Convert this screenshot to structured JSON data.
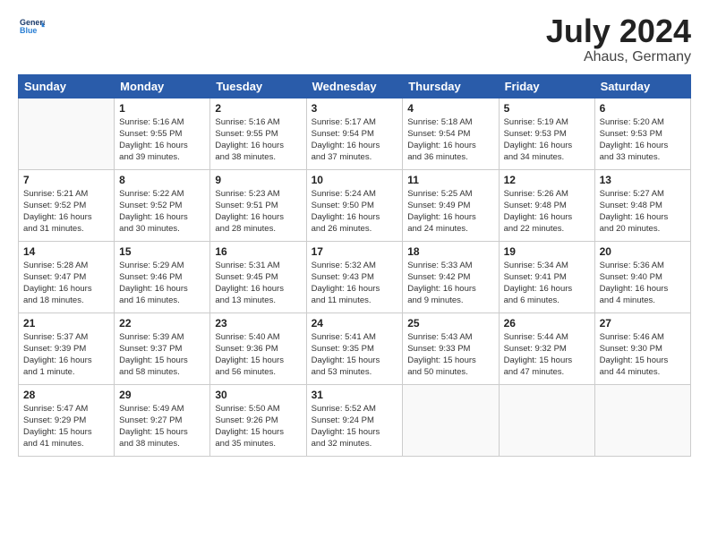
{
  "header": {
    "logo_general": "General",
    "logo_blue": "Blue",
    "title": "July 2024",
    "location": "Ahaus, Germany"
  },
  "weekdays": [
    "Sunday",
    "Monday",
    "Tuesday",
    "Wednesday",
    "Thursday",
    "Friday",
    "Saturday"
  ],
  "weeks": [
    [
      {
        "day": "",
        "info": ""
      },
      {
        "day": "1",
        "info": "Sunrise: 5:16 AM\nSunset: 9:55 PM\nDaylight: 16 hours\nand 39 minutes."
      },
      {
        "day": "2",
        "info": "Sunrise: 5:16 AM\nSunset: 9:55 PM\nDaylight: 16 hours\nand 38 minutes."
      },
      {
        "day": "3",
        "info": "Sunrise: 5:17 AM\nSunset: 9:54 PM\nDaylight: 16 hours\nand 37 minutes."
      },
      {
        "day": "4",
        "info": "Sunrise: 5:18 AM\nSunset: 9:54 PM\nDaylight: 16 hours\nand 36 minutes."
      },
      {
        "day": "5",
        "info": "Sunrise: 5:19 AM\nSunset: 9:53 PM\nDaylight: 16 hours\nand 34 minutes."
      },
      {
        "day": "6",
        "info": "Sunrise: 5:20 AM\nSunset: 9:53 PM\nDaylight: 16 hours\nand 33 minutes."
      }
    ],
    [
      {
        "day": "7",
        "info": "Sunrise: 5:21 AM\nSunset: 9:52 PM\nDaylight: 16 hours\nand 31 minutes."
      },
      {
        "day": "8",
        "info": "Sunrise: 5:22 AM\nSunset: 9:52 PM\nDaylight: 16 hours\nand 30 minutes."
      },
      {
        "day": "9",
        "info": "Sunrise: 5:23 AM\nSunset: 9:51 PM\nDaylight: 16 hours\nand 28 minutes."
      },
      {
        "day": "10",
        "info": "Sunrise: 5:24 AM\nSunset: 9:50 PM\nDaylight: 16 hours\nand 26 minutes."
      },
      {
        "day": "11",
        "info": "Sunrise: 5:25 AM\nSunset: 9:49 PM\nDaylight: 16 hours\nand 24 minutes."
      },
      {
        "day": "12",
        "info": "Sunrise: 5:26 AM\nSunset: 9:48 PM\nDaylight: 16 hours\nand 22 minutes."
      },
      {
        "day": "13",
        "info": "Sunrise: 5:27 AM\nSunset: 9:48 PM\nDaylight: 16 hours\nand 20 minutes."
      }
    ],
    [
      {
        "day": "14",
        "info": "Sunrise: 5:28 AM\nSunset: 9:47 PM\nDaylight: 16 hours\nand 18 minutes."
      },
      {
        "day": "15",
        "info": "Sunrise: 5:29 AM\nSunset: 9:46 PM\nDaylight: 16 hours\nand 16 minutes."
      },
      {
        "day": "16",
        "info": "Sunrise: 5:31 AM\nSunset: 9:45 PM\nDaylight: 16 hours\nand 13 minutes."
      },
      {
        "day": "17",
        "info": "Sunrise: 5:32 AM\nSunset: 9:43 PM\nDaylight: 16 hours\nand 11 minutes."
      },
      {
        "day": "18",
        "info": "Sunrise: 5:33 AM\nSunset: 9:42 PM\nDaylight: 16 hours\nand 9 minutes."
      },
      {
        "day": "19",
        "info": "Sunrise: 5:34 AM\nSunset: 9:41 PM\nDaylight: 16 hours\nand 6 minutes."
      },
      {
        "day": "20",
        "info": "Sunrise: 5:36 AM\nSunset: 9:40 PM\nDaylight: 16 hours\nand 4 minutes."
      }
    ],
    [
      {
        "day": "21",
        "info": "Sunrise: 5:37 AM\nSunset: 9:39 PM\nDaylight: 16 hours\nand 1 minute."
      },
      {
        "day": "22",
        "info": "Sunrise: 5:39 AM\nSunset: 9:37 PM\nDaylight: 15 hours\nand 58 minutes."
      },
      {
        "day": "23",
        "info": "Sunrise: 5:40 AM\nSunset: 9:36 PM\nDaylight: 15 hours\nand 56 minutes."
      },
      {
        "day": "24",
        "info": "Sunrise: 5:41 AM\nSunset: 9:35 PM\nDaylight: 15 hours\nand 53 minutes."
      },
      {
        "day": "25",
        "info": "Sunrise: 5:43 AM\nSunset: 9:33 PM\nDaylight: 15 hours\nand 50 minutes."
      },
      {
        "day": "26",
        "info": "Sunrise: 5:44 AM\nSunset: 9:32 PM\nDaylight: 15 hours\nand 47 minutes."
      },
      {
        "day": "27",
        "info": "Sunrise: 5:46 AM\nSunset: 9:30 PM\nDaylight: 15 hours\nand 44 minutes."
      }
    ],
    [
      {
        "day": "28",
        "info": "Sunrise: 5:47 AM\nSunset: 9:29 PM\nDaylight: 15 hours\nand 41 minutes."
      },
      {
        "day": "29",
        "info": "Sunrise: 5:49 AM\nSunset: 9:27 PM\nDaylight: 15 hours\nand 38 minutes."
      },
      {
        "day": "30",
        "info": "Sunrise: 5:50 AM\nSunset: 9:26 PM\nDaylight: 15 hours\nand 35 minutes."
      },
      {
        "day": "31",
        "info": "Sunrise: 5:52 AM\nSunset: 9:24 PM\nDaylight: 15 hours\nand 32 minutes."
      },
      {
        "day": "",
        "info": ""
      },
      {
        "day": "",
        "info": ""
      },
      {
        "day": "",
        "info": ""
      }
    ]
  ]
}
